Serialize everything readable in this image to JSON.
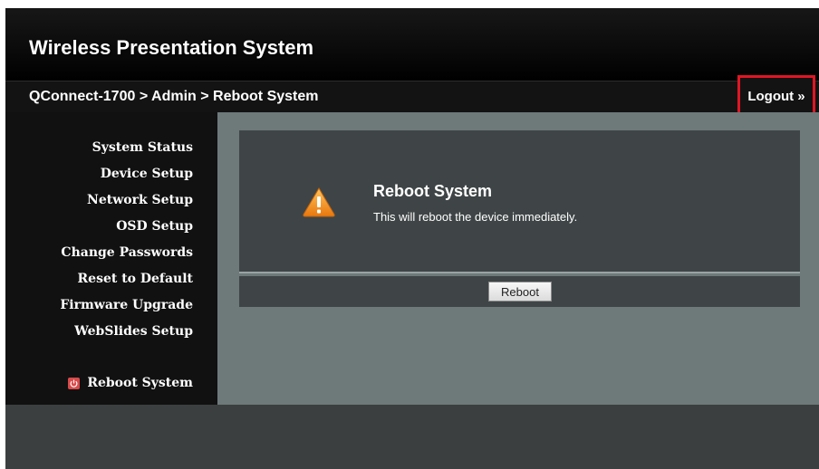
{
  "header": {
    "title": "Wireless Presentation System"
  },
  "breadcrumb": "QConnect-1700 > Admin > Reboot System",
  "logout_label": "Logout »",
  "sidebar": {
    "items": [
      {
        "label": "System Status"
      },
      {
        "label": "Device Setup"
      },
      {
        "label": "Network Setup"
      },
      {
        "label": "OSD Setup"
      },
      {
        "label": "Change Passwords"
      },
      {
        "label": "Reset to Default"
      },
      {
        "label": "Firmware Upgrade"
      },
      {
        "label": "WebSlides Setup"
      }
    ],
    "active_item": {
      "label": "Reboot System",
      "icon": "power-icon"
    }
  },
  "panel": {
    "icon": "warning-icon",
    "title": "Reboot System",
    "description": "This will reboot the device immediately."
  },
  "actions": {
    "reboot_label": "Reboot"
  },
  "colors": {
    "highlight_border": "#e01624",
    "warning_orange": "#f08a1c",
    "content_bg": "#6e797a",
    "panel_bg": "#3f4546"
  }
}
